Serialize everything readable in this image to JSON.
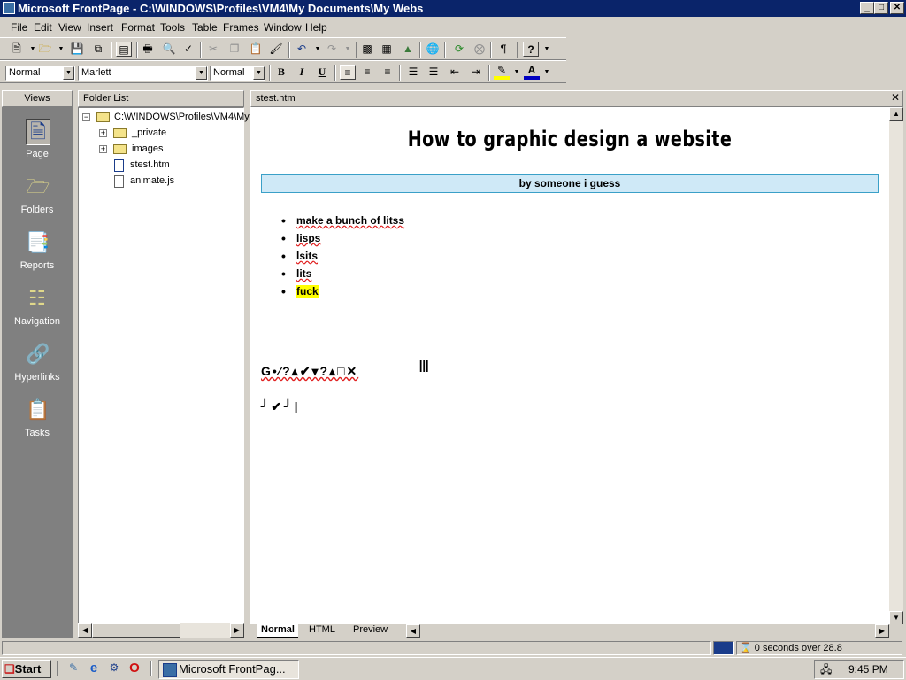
{
  "window": {
    "title": "Microsoft FrontPage - C:\\WINDOWS\\Profiles\\VM4\\My Documents\\My Webs",
    "min": "_",
    "max": "□",
    "close": "✕"
  },
  "menu": [
    "File",
    "Edit",
    "View",
    "Insert",
    "Format",
    "Tools",
    "Table",
    "Frames",
    "Window",
    "Help"
  ],
  "format_toolbar": {
    "style": "Normal",
    "font": "Marlett",
    "size": "Normal",
    "bold": "B",
    "italic": "I",
    "underline": "U"
  },
  "views": {
    "header": "Views",
    "items": [
      {
        "label": "Page",
        "icon": "page-icon"
      },
      {
        "label": "Folders",
        "icon": "folders-icon"
      },
      {
        "label": "Reports",
        "icon": "reports-icon"
      },
      {
        "label": "Navigation",
        "icon": "navigation-icon"
      },
      {
        "label": "Hyperlinks",
        "icon": "hyperlinks-icon"
      },
      {
        "label": "Tasks",
        "icon": "tasks-icon"
      }
    ]
  },
  "folder_list": {
    "header": "Folder List",
    "root": "C:\\WINDOWS\\Profiles\\VM4\\My",
    "items": [
      "_private",
      "images",
      "stest.htm",
      "animate.js"
    ]
  },
  "document": {
    "tab": "stest.htm",
    "title": "How to graphic design a website",
    "byline": "by someone i guess",
    "bullets": [
      "make a bunch of litss",
      "lisps",
      "lsits",
      "lits",
      "fuck"
    ],
    "symbols_line1": "G•∕?▴✔▾?▴□✕",
    "symbols_line2": "╯✔╯|",
    "view_tabs": [
      "Normal",
      "HTML",
      "Preview"
    ]
  },
  "status": {
    "download": "0 seconds over 28.8"
  },
  "taskbar": {
    "start": "Start",
    "task": "Microsoft FrontPag...",
    "clock": "9:45 PM"
  }
}
